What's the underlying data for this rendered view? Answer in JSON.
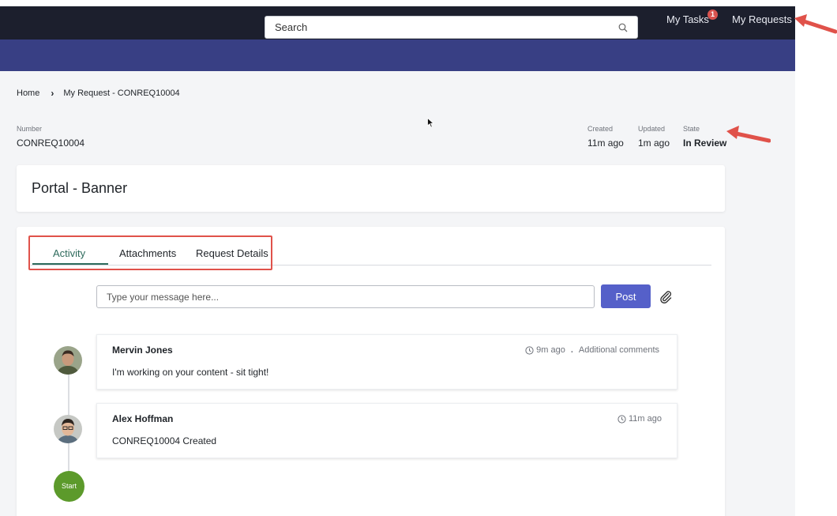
{
  "header": {
    "search_placeholder": "Search",
    "my_tasks_label": "My Tasks",
    "tasks_badge_count": "1",
    "my_requests_label": "My Requests"
  },
  "breadcrumb": {
    "home": "Home",
    "current": "My Request - CONREQ10004"
  },
  "meta": {
    "number_label": "Number",
    "number_value": "CONREQ10004",
    "created_label": "Created",
    "created_value": "11m ago",
    "updated_label": "Updated",
    "updated_value": "1m ago",
    "state_label": "State",
    "state_value": "In Review"
  },
  "title": "Portal - Banner",
  "tabs": [
    {
      "label": "Activity",
      "active": true
    },
    {
      "label": "Attachments",
      "active": false
    },
    {
      "label": "Request Details",
      "active": false
    }
  ],
  "composer": {
    "placeholder": "Type your message here...",
    "post_label": "Post"
  },
  "timeline": [
    {
      "author": "Mervin Jones",
      "time": "9m ago",
      "type": "Additional comments",
      "text": "I'm working on your content - sit tight!"
    },
    {
      "author": "Alex Hoffman",
      "time": "11m ago",
      "text": "CONREQ10004 Created"
    }
  ],
  "start_label": "Start",
  "colors": {
    "topbar": "#1c1f2d",
    "banner": "#383f84",
    "accent_tab": "#2e6b5c",
    "post_button": "#5560c9",
    "start_node": "#5c9a2b",
    "annotation": "#e0524a"
  }
}
